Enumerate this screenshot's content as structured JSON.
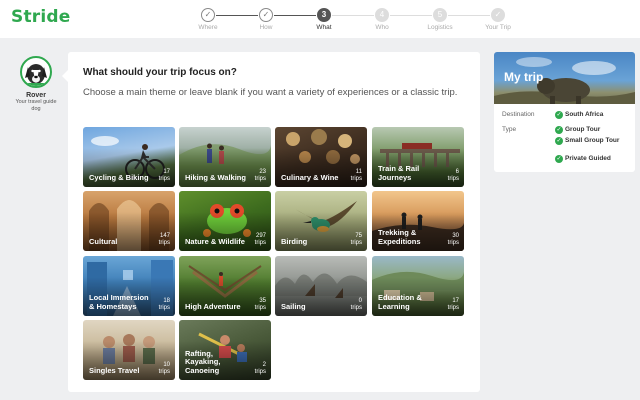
{
  "app": {
    "logo": "Stride"
  },
  "steps": [
    {
      "label": "Where",
      "number": "1",
      "state": "done"
    },
    {
      "label": "How",
      "number": "2",
      "state": "done"
    },
    {
      "label": "What",
      "number": "3",
      "state": "current"
    },
    {
      "label": "Who",
      "number": "4",
      "state": "future"
    },
    {
      "label": "Logistics",
      "number": "5",
      "state": "future"
    },
    {
      "label": "Your Trip",
      "number": "6",
      "state": "future"
    }
  ],
  "agent": {
    "name": "Rover",
    "role": "Your travel guide dog"
  },
  "prompt": {
    "question": "What should your trip focus on?",
    "subtitle": "Choose a main theme or leave blank if you want a variety of experiences or a classic trip."
  },
  "trips_word": "trips",
  "themes": [
    {
      "name": "Cycling & Biking",
      "count": "17"
    },
    {
      "name": "Hiking & Walking",
      "count": "23"
    },
    {
      "name": "Culinary & Wine",
      "count": "11"
    },
    {
      "name": "Train & Rail Journeys",
      "count": "6"
    },
    {
      "name": "Cultural",
      "count": "147"
    },
    {
      "name": "Nature & Wildlife",
      "count": "297"
    },
    {
      "name": "Birding",
      "count": "75"
    },
    {
      "name": "Trekking & Expeditions",
      "count": "30"
    },
    {
      "name": "Local Immersion & Homestays",
      "count": "18"
    },
    {
      "name": "High Adventure",
      "count": "35"
    },
    {
      "name": "Sailing",
      "count": "0"
    },
    {
      "name": "Education & Learning",
      "count": "17"
    },
    {
      "name": "Singles Travel",
      "count": "10"
    },
    {
      "name": "Rafting, Kayaking, Canoeing",
      "count": "2"
    }
  ],
  "my_trip": {
    "title": "My trip",
    "destination_label": "Destination",
    "destination": "South Africa",
    "type_label": "Type",
    "types": [
      "Group Tour",
      "Small Group Tour",
      "Private Guided"
    ]
  },
  "colors": {
    "brand": "#2fa84f"
  }
}
